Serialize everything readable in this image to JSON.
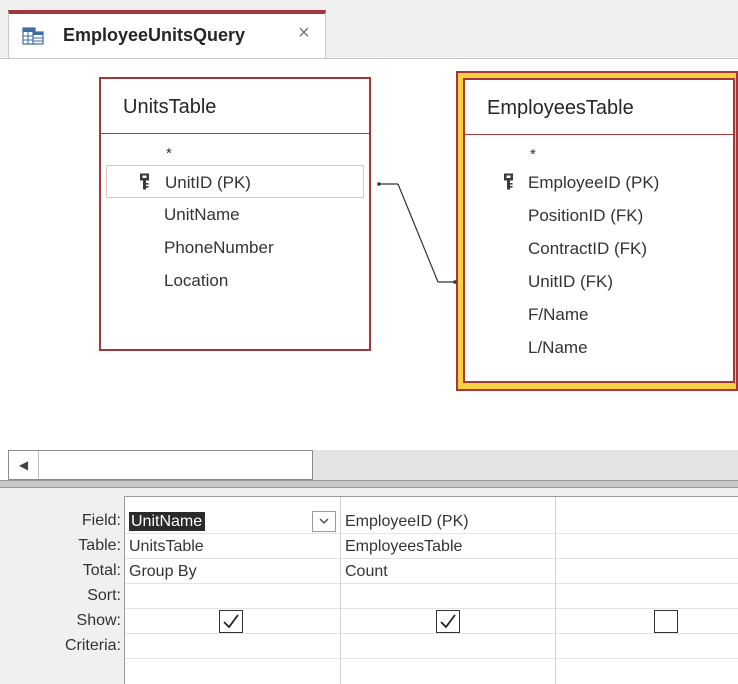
{
  "tab": {
    "title": "EmployeeUnitsQuery",
    "close_glyph": "×",
    "icon": "query-icon"
  },
  "colors": {
    "accent": "#a4373a",
    "selected_highlight": "#f7cf43"
  },
  "tables": {
    "units": {
      "title": "UnitsTable",
      "all_fields": "*",
      "fields": [
        "UnitID (PK)",
        "UnitName",
        "PhoneNumber",
        "Location"
      ]
    },
    "employees": {
      "title": "EmployeesTable",
      "all_fields": "*",
      "fields": [
        "EmployeeID (PK)",
        "PositionID (FK)",
        "ContractID (FK)",
        "UnitID (FK)",
        "F/Name",
        "L/Name"
      ]
    }
  },
  "scroll": {
    "left_arrow": "◀"
  },
  "grid": {
    "row_labels": [
      "Field:",
      "Table:",
      "Total:",
      "Sort:",
      "Show:",
      "Criteria:"
    ],
    "columns": [
      {
        "field": "UnitName",
        "table": "UnitsTable",
        "total": "Group By",
        "sort": "",
        "show": true,
        "criteria": ""
      },
      {
        "field": "EmployeeID (PK)",
        "table": "EmployeesTable",
        "total": "Count",
        "sort": "",
        "show": true,
        "criteria": ""
      },
      {
        "field": "",
        "table": "",
        "total": "",
        "sort": "",
        "show": false,
        "criteria": ""
      }
    ]
  }
}
